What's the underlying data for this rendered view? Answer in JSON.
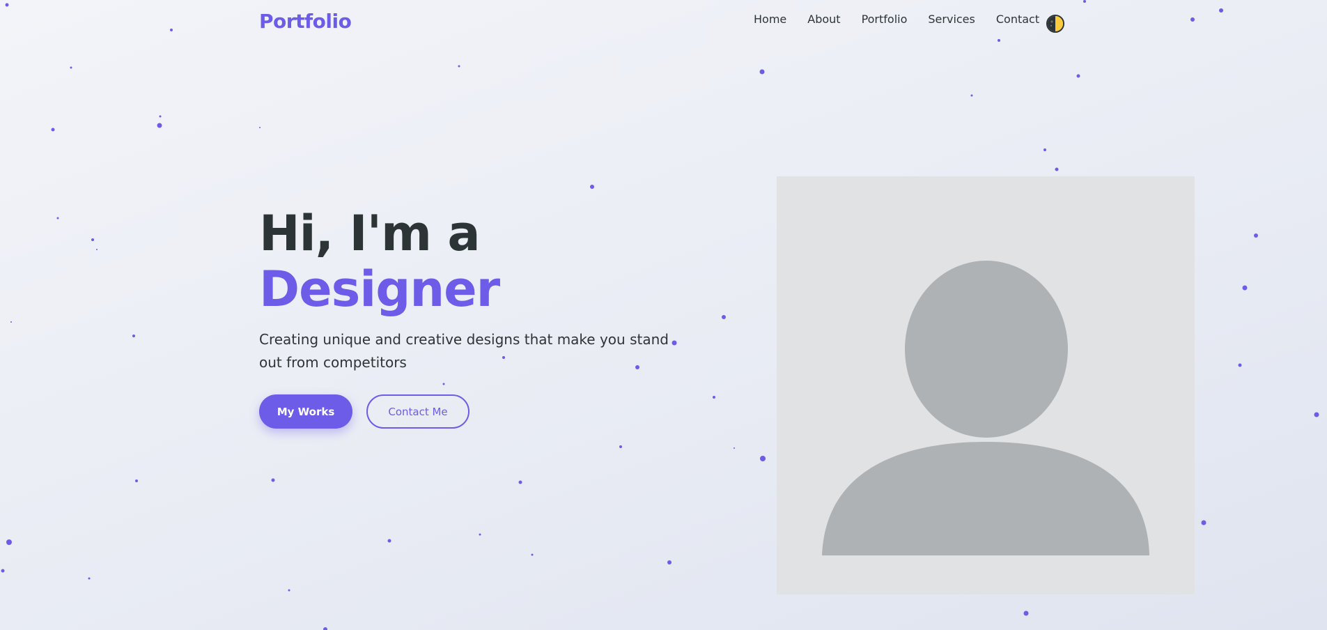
{
  "header": {
    "logo": "Portfolio",
    "nav": [
      "Home",
      "About",
      "Portfolio",
      "Services",
      "Contact"
    ],
    "theme_toggle_icon": "half-moon-sun-icon"
  },
  "hero": {
    "title_line1": "Hi, I'm a",
    "title_line2": "Designer",
    "subtitle": "Creating unique and creative designs that make you stand out from competitors",
    "primary_button": "My Works",
    "secondary_button": "Contact Me"
  },
  "profile": {
    "icon": "person-placeholder-icon"
  },
  "colors": {
    "accent": "#6c5ce7",
    "text": "#2d3436",
    "placeholder_bg": "#e1e2e4",
    "placeholder_figure": "#aeb2b5",
    "toggle_dark": "#2d3436",
    "toggle_light": "#fdcb3e"
  }
}
